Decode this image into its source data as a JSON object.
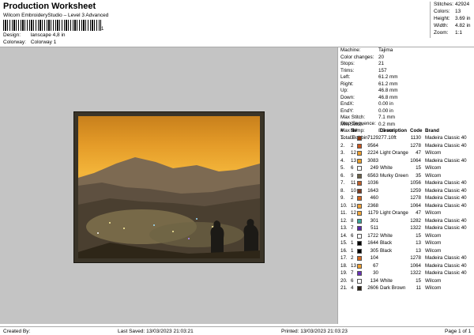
{
  "header": {
    "title": "Production Worksheet",
    "subtitle": "Wilcom EmbroideryStudio – Level 3 Advanced",
    "barcode_tail": "1",
    "design_label": "Design:",
    "design_value": "lanscape 4,8 in",
    "colorway_label": "Colorway:",
    "colorway_value": "Colorway 1"
  },
  "summary": [
    {
      "label": "Stitches:",
      "value": "42924"
    },
    {
      "label": "Colors:",
      "value": "13"
    },
    {
      "label": "Height:",
      "value": "3.69 in"
    },
    {
      "label": "Width:",
      "value": "4.82 in"
    },
    {
      "label": "Zoom:",
      "value": "1:1"
    }
  ],
  "machine_info": [
    {
      "label": "Machine:",
      "value": "Tajima"
    },
    {
      "label": "Color changes:",
      "value": "20"
    },
    {
      "label": "Stops:",
      "value": "21"
    },
    {
      "label": "Trims:",
      "value": "157"
    },
    {
      "label": "Left:",
      "value": "61.2 mm"
    },
    {
      "label": "Right:",
      "value": "61.2 mm"
    },
    {
      "label": "Up:",
      "value": "46.8 mm"
    },
    {
      "label": "Down:",
      "value": "46.8 mm"
    },
    {
      "label": "EndX:",
      "value": "0.00 in"
    },
    {
      "label": "EndY:",
      "value": "0.00 in"
    },
    {
      "label": "Max Stitch:",
      "value": "7.1 mm"
    },
    {
      "label": "Min Stitch:",
      "value": "0.2 mm"
    },
    {
      "label": "Max Jump:",
      "value": "8.0 mm"
    },
    {
      "label": "Total Bobbin:",
      "value": "277.10ft"
    }
  ],
  "sequence": {
    "title": "Stop Sequence:",
    "headers": {
      "index": "#",
      "stop": "N#",
      "number": "",
      "description": "Description",
      "code": "Code",
      "brand": "Brand"
    },
    "rows": [
      {
        "i": "1.",
        "s": "3",
        "color": "#8b3a12",
        "n": "7129",
        "d": "",
        "c": "1130",
        "b": "Madeira Classic 40"
      },
      {
        "i": "2.",
        "s": "2",
        "color": "#c9571d",
        "n": "9564",
        "d": "",
        "c": "1278",
        "b": "Madeira Classic 40"
      },
      {
        "i": "3.",
        "s": "12",
        "color": "#f0a030",
        "n": "2224",
        "d": "Light Orange",
        "c": "47",
        "b": "Wilcom"
      },
      {
        "i": "4.",
        "s": "13",
        "color": "#e8a02c",
        "n": "3083",
        "d": "",
        "c": "1064",
        "b": "Madeira Classic 40"
      },
      {
        "i": "5.",
        "s": "6",
        "color": "#ffffff",
        "n": "249",
        "d": "White",
        "c": "15",
        "b": "Wilcom"
      },
      {
        "i": "6.",
        "s": "9",
        "color": "#6b6147",
        "n": "6563",
        "d": "Murky Green",
        "c": "35",
        "b": "Wilcom"
      },
      {
        "i": "7.",
        "s": "11",
        "color": "#c0602a",
        "n": "1036",
        "d": "",
        "c": "1056",
        "b": "Madeira Classic 40"
      },
      {
        "i": "8.",
        "s": "10",
        "color": "#7a3c24",
        "n": "1643",
        "d": "",
        "c": "1259",
        "b": "Madeira Classic 40"
      },
      {
        "i": "9.",
        "s": "2",
        "color": "#d4661e",
        "n": "460",
        "d": "",
        "c": "1278",
        "b": "Madeira Classic 40"
      },
      {
        "i": "10.",
        "s": "13",
        "color": "#f2a238",
        "n": "2368",
        "d": "",
        "c": "1064",
        "b": "Madeira Classic 40"
      },
      {
        "i": "11.",
        "s": "12",
        "color": "#f4a83a",
        "n": "1179",
        "d": "Light Orange",
        "c": "47",
        "b": "Wilcom"
      },
      {
        "i": "12.",
        "s": "8",
        "color": "#3aa59a",
        "n": "301",
        "d": "",
        "c": "1282",
        "b": "Madeira Classic 40"
      },
      {
        "i": "13.",
        "s": "7",
        "color": "#5a2aa8",
        "n": "511",
        "d": "",
        "c": "1322",
        "b": "Madeira Classic 40"
      },
      {
        "i": "14.",
        "s": "6",
        "color": "#ffffff",
        "n": "1722",
        "d": "White",
        "c": "15",
        "b": "Wilcom"
      },
      {
        "i": "15.",
        "s": "1",
        "color": "#000000",
        "n": "1644",
        "d": "Black",
        "c": "13",
        "b": "Wilcom"
      },
      {
        "i": "16.",
        "s": "1",
        "color": "#000000",
        "n": "305",
        "d": "Black",
        "c": "13",
        "b": "Wilcom"
      },
      {
        "i": "17.",
        "s": "2",
        "color": "#d86a20",
        "n": "104",
        "d": "",
        "c": "1278",
        "b": "Madeira Classic 40"
      },
      {
        "i": "18.",
        "s": "13",
        "color": "#f0a030",
        "n": "67",
        "d": "",
        "c": "1064",
        "b": "Madeira Classic 40"
      },
      {
        "i": "19.",
        "s": "7",
        "color": "#6a32b8",
        "n": "30",
        "d": "",
        "c": "1322",
        "b": "Madeira Classic 40"
      },
      {
        "i": "20.",
        "s": "6",
        "color": "#ffffff",
        "n": "134",
        "d": "White",
        "c": "15",
        "b": "Wilcom"
      },
      {
        "i": "21.",
        "s": "4",
        "color": "#2e2416",
        "n": "2606",
        "d": "Dark Brown",
        "c": "11",
        "b": "Wilcom"
      }
    ]
  },
  "footer": {
    "created_by": "Created By:",
    "last_saved": "Last Saved: 13/03/2023 21:03:21",
    "printed": "Printed: 13/03/2023 21:03:23",
    "page": "Page 1 of 1"
  }
}
